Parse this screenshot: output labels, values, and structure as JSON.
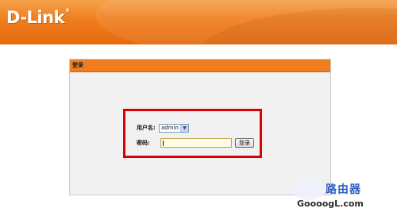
{
  "header": {
    "logo_text": "D-Link",
    "logo_mark": "®",
    "colors": {
      "bar": "#ef7d1d"
    }
  },
  "panel": {
    "title": "登录",
    "username_label": "用户名:",
    "username_value": "admin",
    "password_label": "密码:",
    "password_value": "",
    "login_button": "登录"
  },
  "watermark": {
    "title": "路由器",
    "domain": "GoooogL.com"
  },
  "colors": {
    "highlight_border": "#d80000",
    "panel_bg": "#f1f1f1"
  }
}
